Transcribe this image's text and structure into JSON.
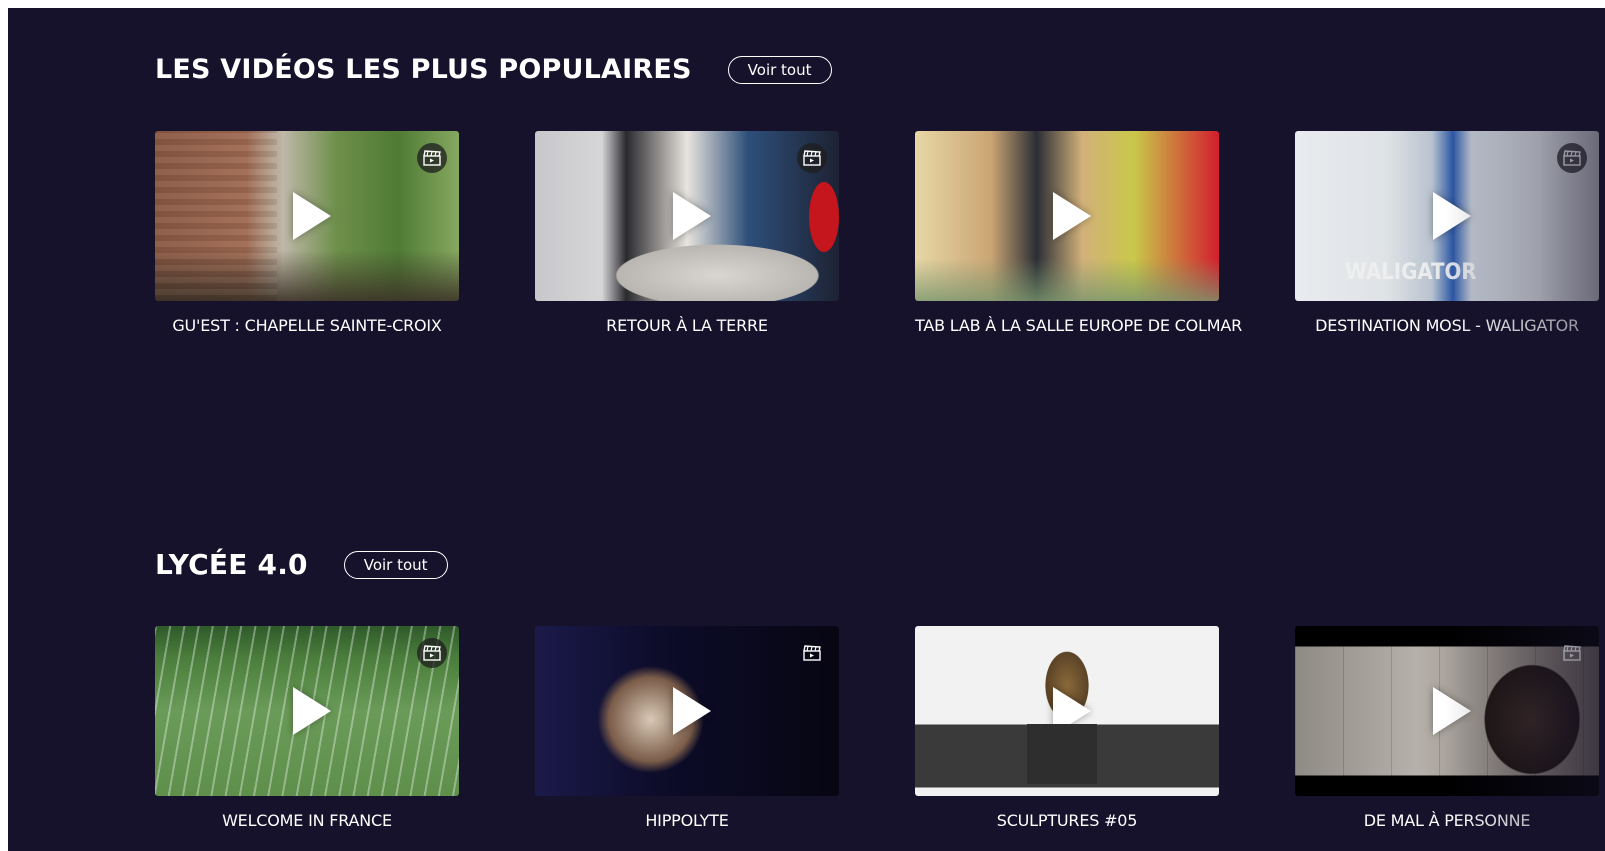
{
  "sections": [
    {
      "title": "LES VIDÉOS LES PLUS POPULAIRES",
      "button": "Voir tout",
      "videos": [
        {
          "title": "GU'EST : CHAPELLE SAINTE-CROIX"
        },
        {
          "title": "RETOUR À LA TERRE"
        },
        {
          "title": "TAB LAB À LA SALLE EUROPE DE COLMAR"
        },
        {
          "title": "DESTINATION MOSL - WALIGATOR"
        }
      ]
    },
    {
      "title": "LYCÉE 4.0",
      "button": "Voir tout",
      "videos": [
        {
          "title": "WELCOME IN FRANCE"
        },
        {
          "title": "HIPPOLYTE"
        },
        {
          "title": "SCULPTURES #05"
        },
        {
          "title": "DE MAL À PERSONNE"
        }
      ]
    }
  ],
  "icons": {
    "play": "play-icon",
    "badge": "clapperboard-icon"
  }
}
